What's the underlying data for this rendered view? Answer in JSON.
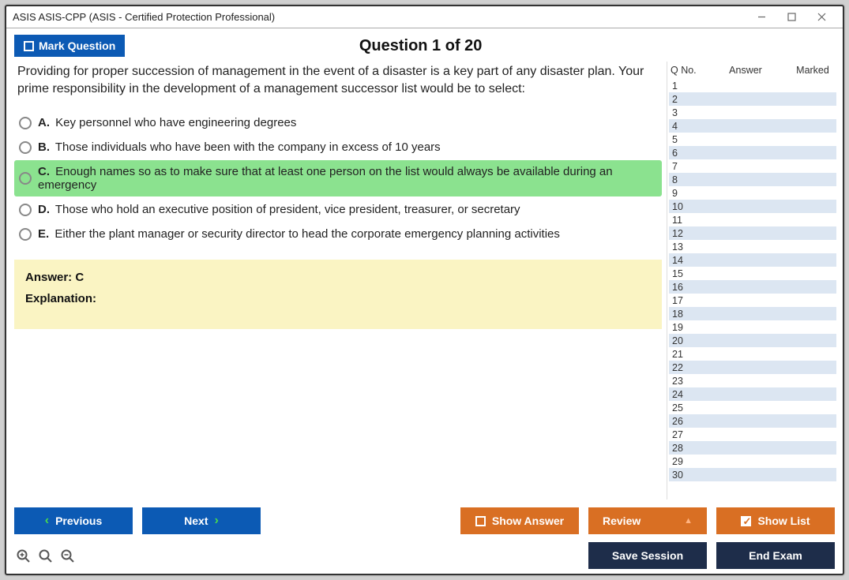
{
  "window": {
    "title": "ASIS ASIS-CPP (ASIS - Certified Protection Professional)"
  },
  "header": {
    "mark_label": "Mark Question",
    "question_title": "Question 1 of 20"
  },
  "question": {
    "stem": "Providing for proper succession of management in the event of a disaster is a key part of any disaster plan. Your prime responsibility in the development of a management successor list would be to select:",
    "options": [
      {
        "letter": "A.",
        "text": "Key personnel who have engineering degrees",
        "selected": false
      },
      {
        "letter": "B.",
        "text": "Those individuals who have been with the company in excess of 10 years",
        "selected": false
      },
      {
        "letter": "C.",
        "text": "Enough names so as to make sure that at least one person on the list would always be available during an emergency",
        "selected": true
      },
      {
        "letter": "D.",
        "text": "Those who hold an executive position of president, vice president, treasurer, or secretary",
        "selected": false
      },
      {
        "letter": "E.",
        "text": "Either the plant manager or security director to head the corporate emergency planning activities",
        "selected": false
      }
    ],
    "answer_label": "Answer: C",
    "explanation_label": "Explanation:"
  },
  "list": {
    "headers": {
      "qno": "Q No.",
      "answer": "Answer",
      "marked": "Marked"
    },
    "total": 30
  },
  "footer": {
    "previous": "Previous",
    "next": "Next",
    "show_answer": "Show Answer",
    "review": "Review",
    "show_list": "Show List",
    "save_session": "Save Session",
    "end_exam": "End Exam"
  }
}
